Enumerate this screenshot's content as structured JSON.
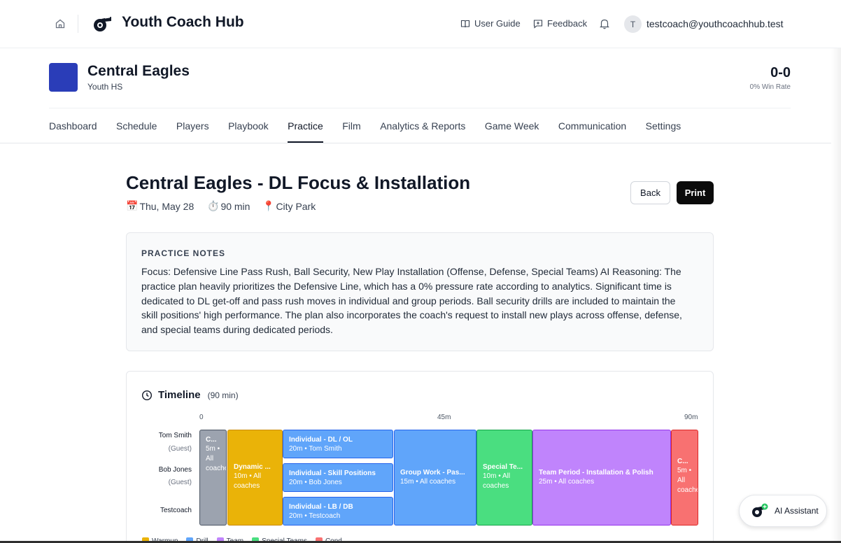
{
  "app": {
    "title": "Youth Coach Hub"
  },
  "topnav": {
    "user_guide": "User Guide",
    "feedback": "Feedback",
    "avatar_initial": "T",
    "user_email": "testcoach@youthcoachhub.test"
  },
  "team": {
    "name": "Central Eagles",
    "level": "Youth HS",
    "record": "0-0",
    "win_rate": "0% Win Rate",
    "logo_color": "#2a3db8"
  },
  "nav": {
    "items": [
      "Dashboard",
      "Schedule",
      "Players",
      "Playbook",
      "Practice",
      "Film",
      "Analytics & Reports",
      "Game Week",
      "Communication",
      "Settings"
    ],
    "active": "Practice"
  },
  "practice": {
    "title": "Central Eagles - DL Focus & Installation",
    "date": "Thu, May 28",
    "duration": "90 min",
    "location": "City Park",
    "back_label": "Back",
    "print_label": "Print"
  },
  "notes": {
    "heading": "PRACTICE NOTES",
    "body": "Focus: Defensive Line Pass Rush, Ball Security, New Play Installation (Offense, Defense, Special Teams) AI Reasoning: The practice plan heavily prioritizes the Defensive Line, which has a 0% pressure rate according to analytics. Significant time is dedicated to DL get-off and pass rush moves in individual and group periods. Ball security drills are included to maintain the skill positions' high performance. The plan also incorporates the coach's request to install new plays across offense, defense, and special teams during dedicated periods."
  },
  "timeline": {
    "heading": "Timeline",
    "duration_label": "(90 min)",
    "ticks": [
      "0",
      "45m",
      "90m"
    ],
    "lanes": [
      {
        "name": "Tom Smith",
        "sub": "(Guest)"
      },
      {
        "name": "Bob Jones",
        "sub": "(Guest)"
      },
      {
        "name": "Testcoach",
        "sub": ""
      }
    ],
    "blocks": [
      {
        "title": "C...",
        "detail": "5m • All coaches",
        "kind": "gray"
      },
      {
        "title": "Dynamic ...",
        "detail": "10m • All coaches",
        "kind": "warmup"
      },
      {
        "title": "Individual - DL / OL",
        "detail": "20m • Tom Smith",
        "kind": "drill"
      },
      {
        "title": "Individual - Skill Positions",
        "detail": "20m • Bob Jones",
        "kind": "drill"
      },
      {
        "title": "Individual - LB / DB",
        "detail": "20m • Testcoach",
        "kind": "drill"
      },
      {
        "title": "Group Work - Pas...",
        "detail": "15m • All coaches",
        "kind": "drill"
      },
      {
        "title": "Special Te...",
        "detail": "10m • All coaches",
        "kind": "special"
      },
      {
        "title": "Team Period - Installation & Polish",
        "detail": "25m • All coaches",
        "kind": "team"
      },
      {
        "title": "C...",
        "detail": "5m • All coaches",
        "kind": "cond"
      }
    ],
    "legend": [
      "Warmup",
      "Drill",
      "Team",
      "Special Teams",
      "Cond"
    ],
    "colors": {
      "gray": "#9ca3af",
      "warmup": "#eab308",
      "drill": "#60a5fa",
      "team": "#c084fc",
      "special": "#4ade80",
      "cond": "#f87171"
    }
  },
  "ai": {
    "label": "AI Assistant"
  }
}
